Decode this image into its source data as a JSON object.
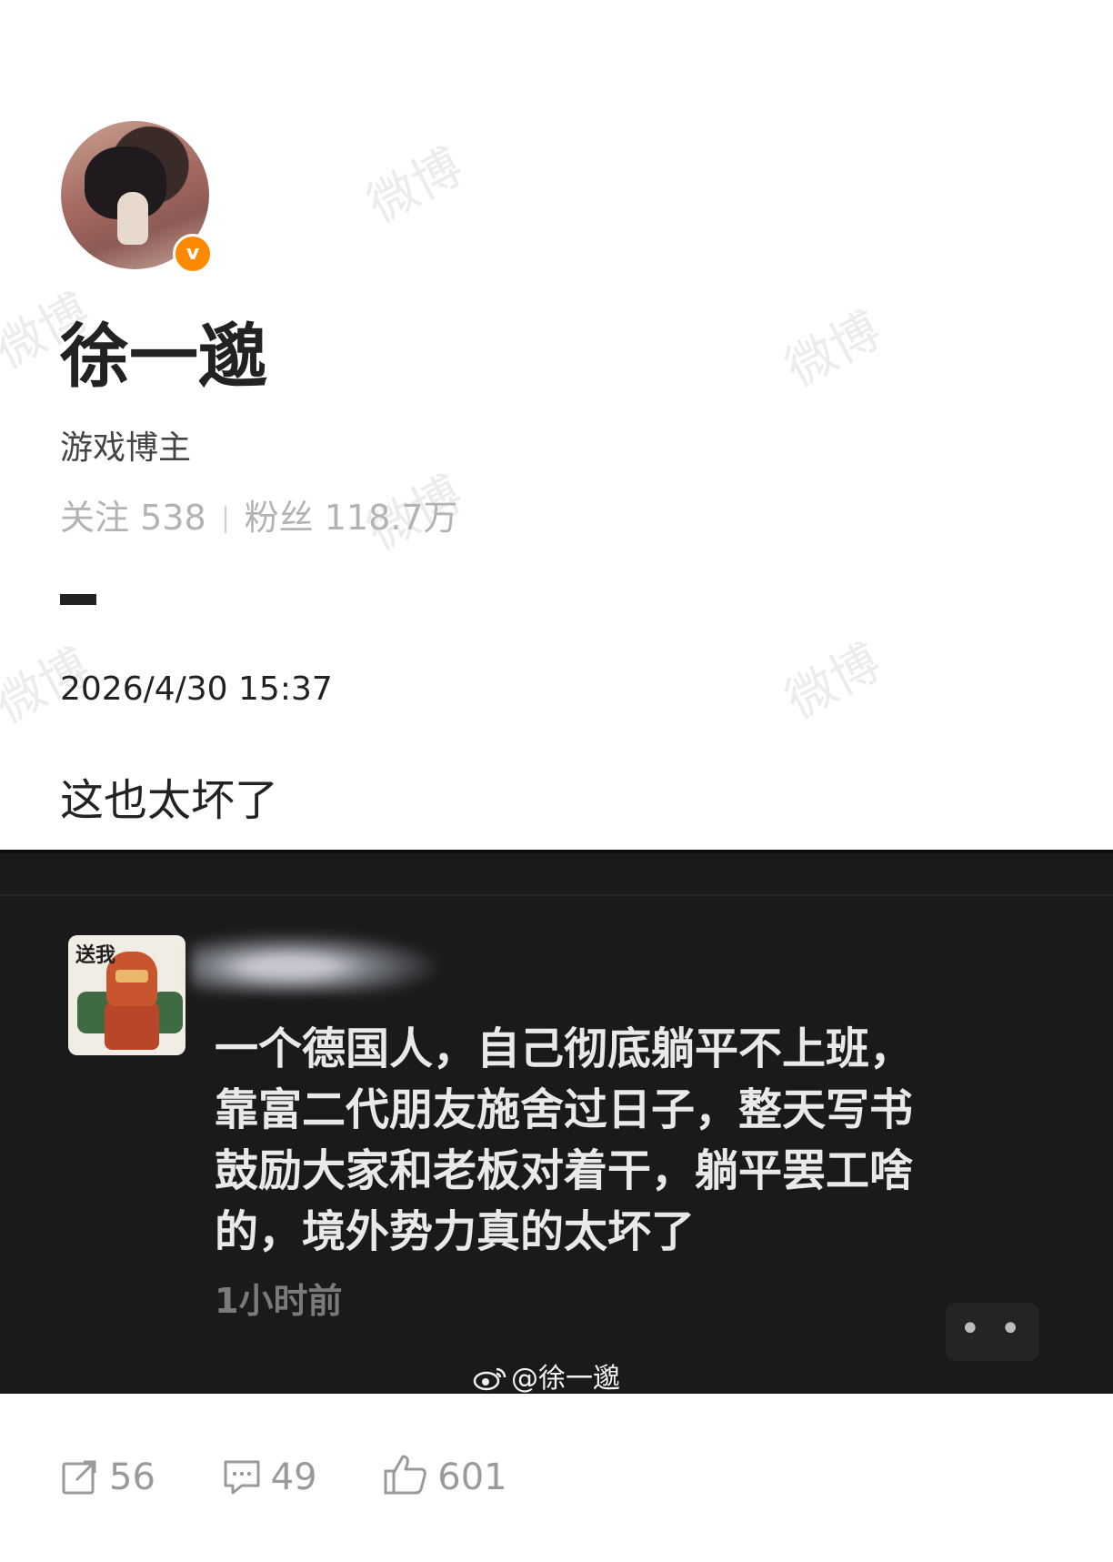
{
  "profile": {
    "name": "徐一邈",
    "bio": "游戏博主",
    "following_label": "关注",
    "following_count": "538",
    "followers_label": "粉丝",
    "followers_count": "118.7万",
    "verified_badge": "v"
  },
  "post": {
    "timestamp": "2026/4/30 15:37",
    "text": "这也太坏了"
  },
  "screenshot": {
    "sticker_label": "送我",
    "comment_lines": [
      "一个德国人，自己彻底躺平不上班，",
      "靠富二代朋友施舍过日子，整天写书",
      "鼓励大家和老板对着干，躺平罢工啥",
      "的，境外势力真的太坏了"
    ],
    "relative_time": "1小时前",
    "more_glyph": "• •",
    "watermark_handle": "@徐一邈"
  },
  "watermark_text": "微博",
  "actions": {
    "repost_count": "56",
    "comment_count": "49",
    "like_count": "601"
  },
  "colors": {
    "verified": "#ff8a00",
    "dark_bg": "#1a1a1a",
    "muted": "#9a9a9a"
  }
}
